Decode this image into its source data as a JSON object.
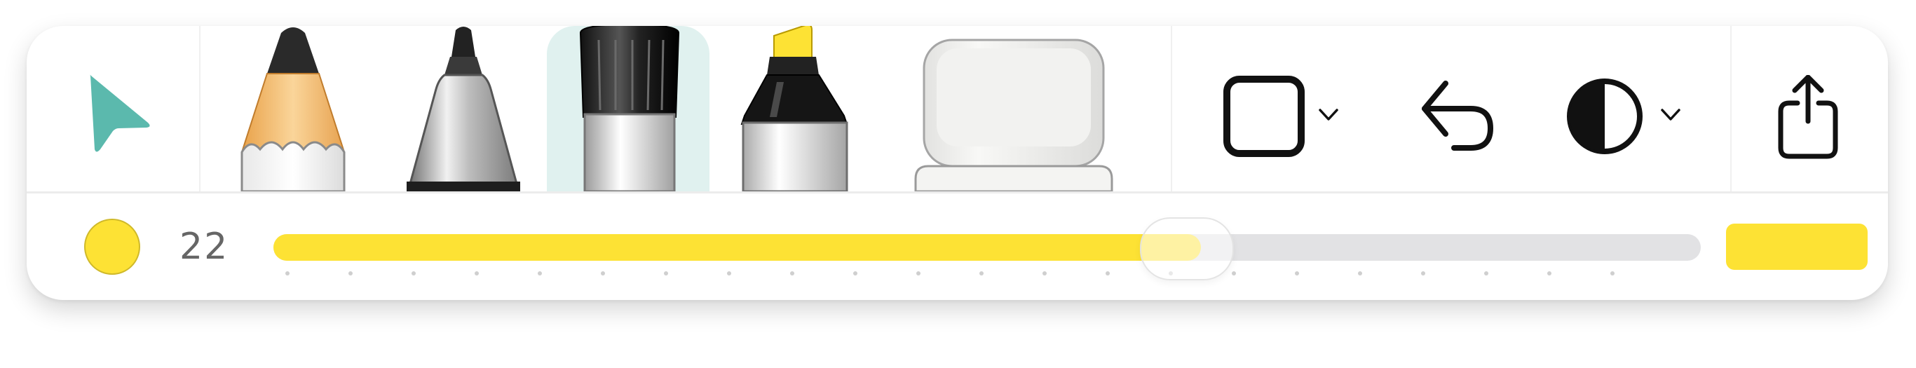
{
  "toolbar": {
    "tools": [
      {
        "name": "lasso-select",
        "icon": "lasso-arrow-icon",
        "selected": false
      },
      {
        "name": "pencil",
        "icon": "pencil-icon",
        "selected": false
      },
      {
        "name": "pen",
        "icon": "pen-icon",
        "selected": false
      },
      {
        "name": "marker",
        "icon": "marker-icon",
        "selected": true
      },
      {
        "name": "highlighter",
        "icon": "highlighter-icon",
        "selected": false
      },
      {
        "name": "eraser",
        "icon": "eraser-icon",
        "selected": false
      }
    ],
    "actions": [
      {
        "name": "shapes",
        "icon": "square-icon",
        "has_menu": true
      },
      {
        "name": "undo",
        "icon": "undo-arrow-icon",
        "has_menu": false
      },
      {
        "name": "contrast",
        "icon": "contrast-icon",
        "has_menu": true
      },
      {
        "name": "share",
        "icon": "share-icon",
        "has_menu": false
      }
    ]
  },
  "stroke": {
    "color": "#fde234",
    "size_label": "22",
    "size_fraction": 0.65,
    "tick_count": 22
  },
  "colors": {
    "accent_teal": "#5bb9ad",
    "selected_tool_bg": "#e0f1ef",
    "yellow": "#fde234",
    "track": "#e2e2e4"
  }
}
